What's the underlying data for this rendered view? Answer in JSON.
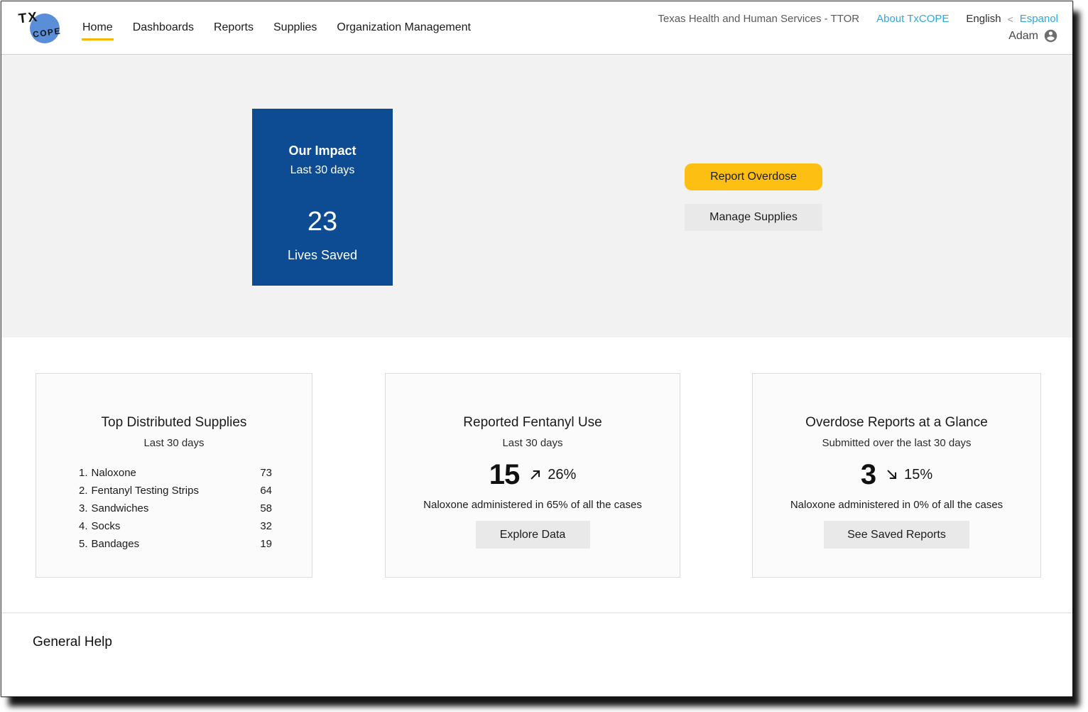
{
  "header": {
    "logo": {
      "tx": "TX",
      "cope": "COPE"
    },
    "nav": [
      {
        "label": "Home",
        "active": true
      },
      {
        "label": "Dashboards",
        "active": false
      },
      {
        "label": "Reports",
        "active": false
      },
      {
        "label": "Supplies",
        "active": false
      },
      {
        "label": "Organization Management",
        "active": false
      }
    ],
    "org_label": "Texas Health and Human Services - TTOR",
    "about_link": "About TxCOPE",
    "language": {
      "current": "English",
      "separator": "<",
      "other": "Espanol"
    },
    "user": {
      "name": "Adam"
    }
  },
  "hero": {
    "impact_card": {
      "title": "Our Impact",
      "subtitle": "Last 30 days",
      "value": "23",
      "caption": "Lives Saved"
    },
    "actions": {
      "report_overdose": "Report Overdose",
      "manage_supplies": "Manage Supplies"
    }
  },
  "cards": {
    "supplies": {
      "title": "Top Distributed Supplies",
      "subtitle": "Last 30 days",
      "items": [
        {
          "rank": "1.",
          "name": "Naloxone",
          "count": "73"
        },
        {
          "rank": "2.",
          "name": "Fentanyl Testing Strips",
          "count": "64"
        },
        {
          "rank": "3.",
          "name": "Sandwiches",
          "count": "58"
        },
        {
          "rank": "4.",
          "name": "Socks",
          "count": "32"
        },
        {
          "rank": "5.",
          "name": "Bandages",
          "count": "19"
        }
      ]
    },
    "fentanyl": {
      "title": "Reported Fentanyl Use",
      "subtitle": "Last 30 days",
      "value": "15",
      "trend_direction": "up",
      "trend_pct": "26%",
      "caption": "Naloxone administered in 65% of all the cases",
      "button": "Explore Data"
    },
    "overdose": {
      "title": "Overdose Reports at a Glance",
      "subtitle": "Submitted over the last 30 days",
      "value": "3",
      "trend_direction": "down",
      "trend_pct": "15%",
      "caption": "Naloxone administered in 0% of all the cases",
      "button": "See Saved Reports"
    }
  },
  "help": {
    "title": "General Help"
  },
  "colors": {
    "impact_blue": "#0d4c92",
    "primary_yellow": "#fcbf12",
    "active_tab_underline": "#f5b700",
    "link_blue": "#2fa8e0",
    "hero_background": "#f2f2f2",
    "card_background": "#fbfbfb",
    "button_gray": "#e9e9e9"
  }
}
